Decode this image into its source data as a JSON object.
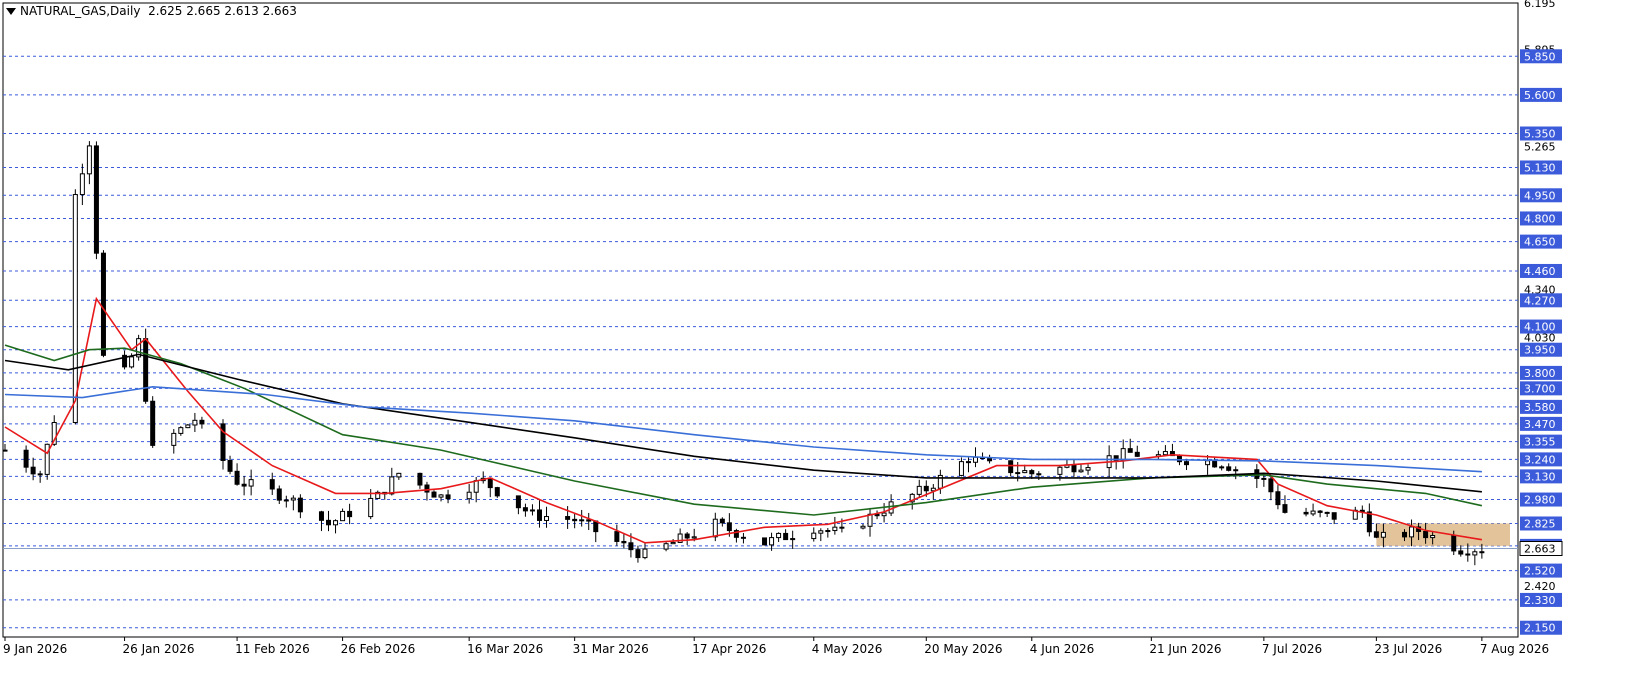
{
  "header": {
    "symbol": "NATURAL_GAS,Daily",
    "ohlc": "2.625 2.665 2.613 2.663"
  },
  "colors": {
    "background": "#ffffff",
    "grid": "#3b5bdb",
    "hline_label_bg": "#3b5bdb",
    "candle": "#000000",
    "ma_fast": "#e8191b",
    "ma_mid": "#1e6b1e",
    "ma_slow": "#000000",
    "ma_long": "#3a6fd8",
    "zone": "#deb887"
  },
  "chart_data": {
    "type": "candlestick",
    "title": "NATURAL_GAS,Daily",
    "y_range": [
      2.09,
      6.195
    ],
    "x_range": [
      "2026-01-09",
      "2026-08-11"
    ],
    "price_tick_labels": [
      "6.195",
      "5.895",
      "5.265",
      "4.340",
      "4.030",
      "2.420",
      "2.150"
    ],
    "horizontal_levels": [
      "5.850",
      "5.600",
      "5.350",
      "5.130",
      "4.950",
      "4.800",
      "4.650",
      "4.460",
      "4.270",
      "4.100",
      "3.950",
      "3.800",
      "3.700",
      "3.580",
      "3.470",
      "3.355",
      "3.240",
      "3.130",
      "2.980",
      "2.825",
      "2.680",
      "2.520",
      "2.330",
      "2.150"
    ],
    "current_price": 2.663,
    "x_tick_labels": [
      {
        "date": "2026-01-09",
        "label": "9 Jan 2026"
      },
      {
        "date": "2026-01-26",
        "label": "26 Jan 2026"
      },
      {
        "date": "2026-02-11",
        "label": "11 Feb 2026"
      },
      {
        "date": "2026-02-26",
        "label": "26 Feb 2026"
      },
      {
        "date": "2026-03-16",
        "label": "16 Mar 2026"
      },
      {
        "date": "2026-03-31",
        "label": "31 Mar 2026"
      },
      {
        "date": "2026-04-17",
        "label": "17 Apr 2026"
      },
      {
        "date": "2026-05-04",
        "label": "4 May 2026"
      },
      {
        "date": "2026-05-20",
        "label": "20 May 2026"
      },
      {
        "date": "2026-06-04",
        "label": "4 Jun 2026"
      },
      {
        "date": "2026-06-21",
        "label": "21 Jun 2026"
      },
      {
        "date": "2026-07-07",
        "label": "7 Jul 2026"
      },
      {
        "date": "2026-07-23",
        "label": "23 Jul 2026"
      },
      {
        "date": "2026-08-07",
        "label": "7 Aug 2026"
      }
    ],
    "zone": {
      "x_start": "2026-07-23",
      "x_end": "2026-08-11",
      "y_low": 2.68,
      "y_high": 2.825
    },
    "candle_keypoints": [
      {
        "date": "2026-01-09",
        "close": 3.3
      },
      {
        "date": "2026-01-14",
        "close": 3.15
      },
      {
        "date": "2026-01-16",
        "close": 3.5
      },
      {
        "date": "2026-01-19",
        "close": 4.95
      },
      {
        "date": "2026-01-21",
        "close": 5.3
      },
      {
        "date": "2026-01-23",
        "close": 3.9
      },
      {
        "date": "2026-01-26",
        "close": 3.8
      },
      {
        "date": "2026-01-28",
        "close": 4.0
      },
      {
        "date": "2026-01-30",
        "close": 3.3
      },
      {
        "date": "2026-02-05",
        "close": 3.5
      },
      {
        "date": "2026-02-11",
        "close": 3.1
      },
      {
        "date": "2026-02-18",
        "close": 3.0
      },
      {
        "date": "2026-02-24",
        "close": 2.82
      },
      {
        "date": "2026-03-03",
        "close": 3.0
      },
      {
        "date": "2026-03-06",
        "close": 3.15
      },
      {
        "date": "2026-03-12",
        "close": 3.0
      },
      {
        "date": "2026-03-18",
        "close": 3.1
      },
      {
        "date": "2026-03-25",
        "close": 2.88
      },
      {
        "date": "2026-03-31",
        "close": 2.85
      },
      {
        "date": "2026-04-07",
        "close": 2.68
      },
      {
        "date": "2026-04-10",
        "close": 2.62
      },
      {
        "date": "2026-04-14",
        "close": 2.7
      },
      {
        "date": "2026-04-20",
        "close": 2.82
      },
      {
        "date": "2026-04-27",
        "close": 2.7
      },
      {
        "date": "2026-05-04",
        "close": 2.8
      },
      {
        "date": "2026-05-08",
        "close": 2.76
      },
      {
        "date": "2026-05-14",
        "close": 2.92
      },
      {
        "date": "2026-05-20",
        "close": 3.05
      },
      {
        "date": "2026-05-26",
        "close": 3.25
      },
      {
        "date": "2026-05-29",
        "close": 3.2
      },
      {
        "date": "2026-06-04",
        "close": 3.15
      },
      {
        "date": "2026-06-10",
        "close": 3.2
      },
      {
        "date": "2026-06-18",
        "close": 3.28
      },
      {
        "date": "2026-06-24",
        "close": 3.25
      },
      {
        "date": "2026-07-01",
        "close": 3.22
      },
      {
        "date": "2026-07-07",
        "close": 3.1
      },
      {
        "date": "2026-07-10",
        "close": 2.9
      },
      {
        "date": "2026-07-17",
        "close": 2.87
      },
      {
        "date": "2026-07-21",
        "close": 2.9
      },
      {
        "date": "2026-07-23",
        "close": 2.72
      },
      {
        "date": "2026-07-29",
        "close": 2.78
      },
      {
        "date": "2026-08-04",
        "close": 2.66
      },
      {
        "date": "2026-08-07",
        "close": 2.663
      }
    ],
    "moving_averages": [
      {
        "color": "ma_fast",
        "points": [
          [
            "2026-01-09",
            3.45
          ],
          [
            "2026-01-15",
            3.28
          ],
          [
            "2026-01-19",
            3.62
          ],
          [
            "2026-01-22",
            4.28
          ],
          [
            "2026-01-27",
            3.95
          ],
          [
            "2026-01-29",
            4.02
          ],
          [
            "2026-02-04",
            3.68
          ],
          [
            "2026-02-09",
            3.42
          ],
          [
            "2026-02-16",
            3.2
          ],
          [
            "2026-02-25",
            3.02
          ],
          [
            "2026-03-04",
            3.02
          ],
          [
            "2026-03-12",
            3.05
          ],
          [
            "2026-03-19",
            3.12
          ],
          [
            "2026-03-27",
            2.96
          ],
          [
            "2026-04-03",
            2.84
          ],
          [
            "2026-04-10",
            2.7
          ],
          [
            "2026-04-17",
            2.72
          ],
          [
            "2026-04-27",
            2.8
          ],
          [
            "2026-05-06",
            2.82
          ],
          [
            "2026-05-14",
            2.9
          ],
          [
            "2026-05-22",
            3.05
          ],
          [
            "2026-05-30",
            3.2
          ],
          [
            "2026-06-08",
            3.2
          ],
          [
            "2026-06-17",
            3.23
          ],
          [
            "2026-06-24",
            3.27
          ],
          [
            "2026-07-06",
            3.24
          ],
          [
            "2026-07-09",
            3.08
          ],
          [
            "2026-07-16",
            2.94
          ],
          [
            "2026-07-23",
            2.88
          ],
          [
            "2026-07-30",
            2.78
          ],
          [
            "2026-08-07",
            2.72
          ]
        ]
      },
      {
        "color": "ma_mid",
        "points": [
          [
            "2026-01-09",
            3.98
          ],
          [
            "2026-01-16",
            3.88
          ],
          [
            "2026-01-21",
            3.95
          ],
          [
            "2026-01-26",
            3.96
          ],
          [
            "2026-02-03",
            3.86
          ],
          [
            "2026-02-12",
            3.7
          ],
          [
            "2026-02-26",
            3.4
          ],
          [
            "2026-03-12",
            3.3
          ],
          [
            "2026-03-31",
            3.1
          ],
          [
            "2026-04-17",
            2.95
          ],
          [
            "2026-05-04",
            2.88
          ],
          [
            "2026-05-20",
            2.96
          ],
          [
            "2026-06-04",
            3.06
          ],
          [
            "2026-06-21",
            3.12
          ],
          [
            "2026-07-07",
            3.14
          ],
          [
            "2026-07-16",
            3.08
          ],
          [
            "2026-07-30",
            3.02
          ],
          [
            "2026-08-07",
            2.94
          ]
        ]
      },
      {
        "color": "ma_slow",
        "points": [
          [
            "2026-01-09",
            3.88
          ],
          [
            "2026-01-18",
            3.82
          ],
          [
            "2026-01-28",
            3.92
          ],
          [
            "2026-02-11",
            3.76
          ],
          [
            "2026-02-26",
            3.6
          ],
          [
            "2026-03-16",
            3.48
          ],
          [
            "2026-03-31",
            3.38
          ],
          [
            "2026-04-17",
            3.26
          ],
          [
            "2026-05-04",
            3.17
          ],
          [
            "2026-05-20",
            3.12
          ],
          [
            "2026-06-04",
            3.12
          ],
          [
            "2026-06-21",
            3.12
          ],
          [
            "2026-07-07",
            3.15
          ],
          [
            "2026-07-23",
            3.1
          ],
          [
            "2026-08-07",
            3.03
          ]
        ]
      },
      {
        "color": "ma_long",
        "points": [
          [
            "2026-01-09",
            3.66
          ],
          [
            "2026-01-20",
            3.64
          ],
          [
            "2026-01-30",
            3.71
          ],
          [
            "2026-02-15",
            3.66
          ],
          [
            "2026-03-01",
            3.58
          ],
          [
            "2026-03-16",
            3.54
          ],
          [
            "2026-03-31",
            3.49
          ],
          [
            "2026-04-17",
            3.4
          ],
          [
            "2026-05-04",
            3.32
          ],
          [
            "2026-05-20",
            3.27
          ],
          [
            "2026-06-04",
            3.24
          ],
          [
            "2026-06-21",
            3.24
          ],
          [
            "2026-07-07",
            3.23
          ],
          [
            "2026-07-23",
            3.2
          ],
          [
            "2026-08-07",
            3.16
          ]
        ]
      }
    ]
  }
}
